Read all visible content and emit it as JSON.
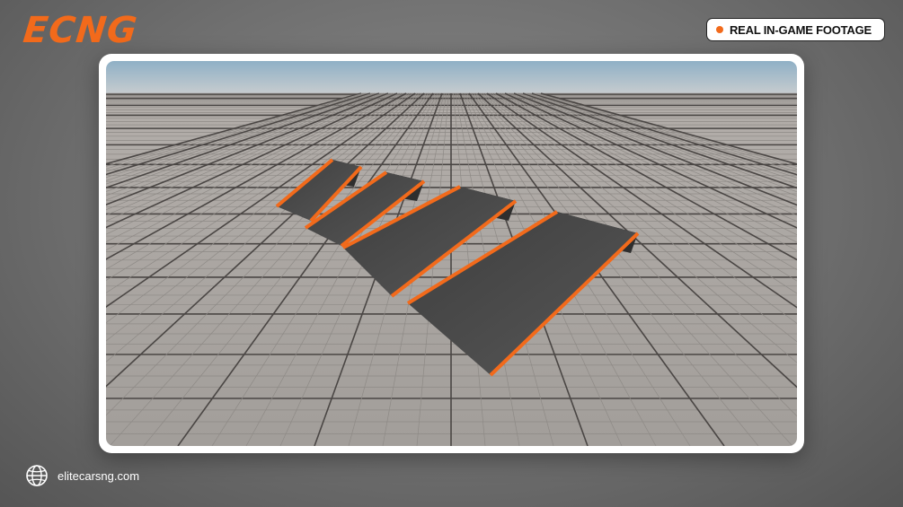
{
  "brand": {
    "logo_text": "ECNG",
    "accent_color": "#f26a1b"
  },
  "badge": {
    "label": "REAL IN-GAME FOOTAGE",
    "dot_color": "#f26a1b"
  },
  "scene": {
    "description_icon": "ramp-obstacles",
    "ramp_count": 4,
    "sky_color": "#9fb8c9",
    "ground_color": "#a9a5a1",
    "ramp_color": "#4a4a4a",
    "ramp_edge_color": "#f26a1b"
  },
  "footer": {
    "icon": "globe-icon",
    "website": "elitecarsng.com"
  }
}
